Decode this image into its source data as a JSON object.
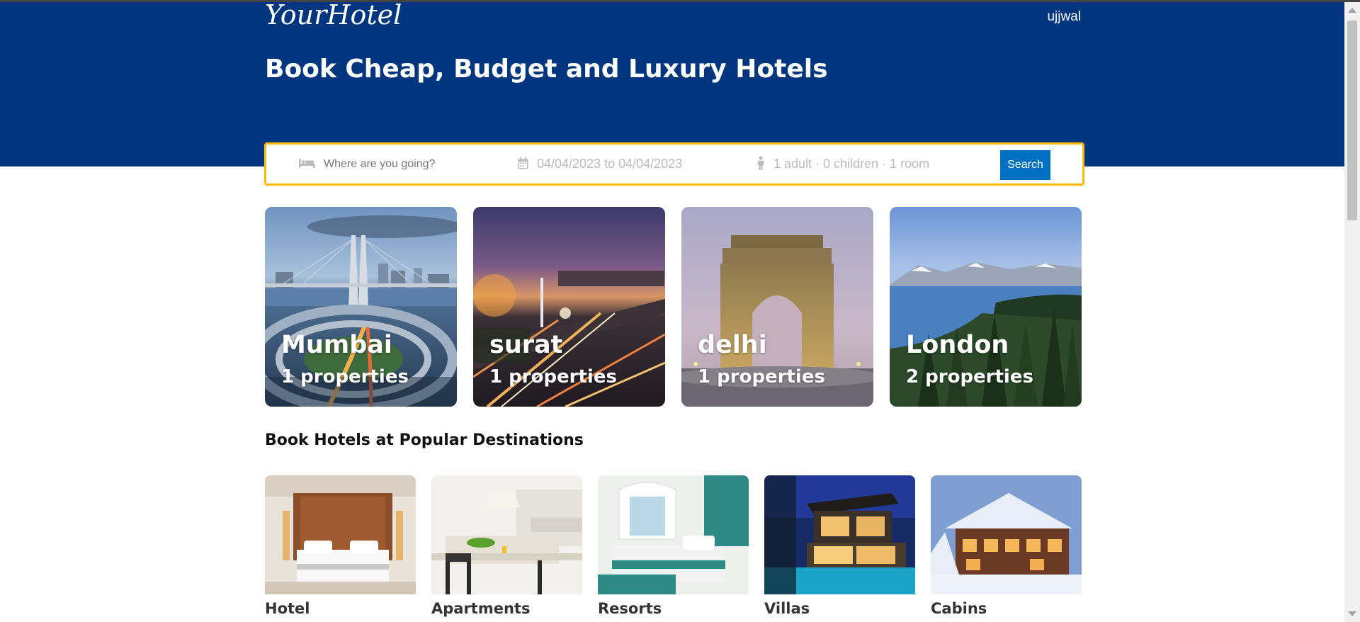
{
  "brand": {
    "logo": "YourHotel"
  },
  "user": {
    "name": "ujjwal"
  },
  "hero": {
    "title": "Book Cheap, Budget and Luxury Hotels"
  },
  "search": {
    "destination_placeholder": "Where are you going?",
    "dates": "04/04/2023 to 04/04/2023",
    "guests": "1 adult · 0 children · 1 room",
    "button": "Search"
  },
  "featured": [
    {
      "city": "Mumbai",
      "properties": "1 properties"
    },
    {
      "city": "surat",
      "properties": "1 properties"
    },
    {
      "city": "delhi",
      "properties": "1 properties"
    },
    {
      "city": "London",
      "properties": "2 properties"
    }
  ],
  "popular": {
    "title": "Book Hotels at Popular Destinations",
    "types": [
      {
        "label": "Hotel"
      },
      {
        "label": "Apartments"
      },
      {
        "label": "Resorts"
      },
      {
        "label": "Villas"
      },
      {
        "label": "Cabins"
      }
    ]
  },
  "colors": {
    "header_bg": "#003580",
    "search_border": "#febb02",
    "button_bg": "#0071c2"
  }
}
